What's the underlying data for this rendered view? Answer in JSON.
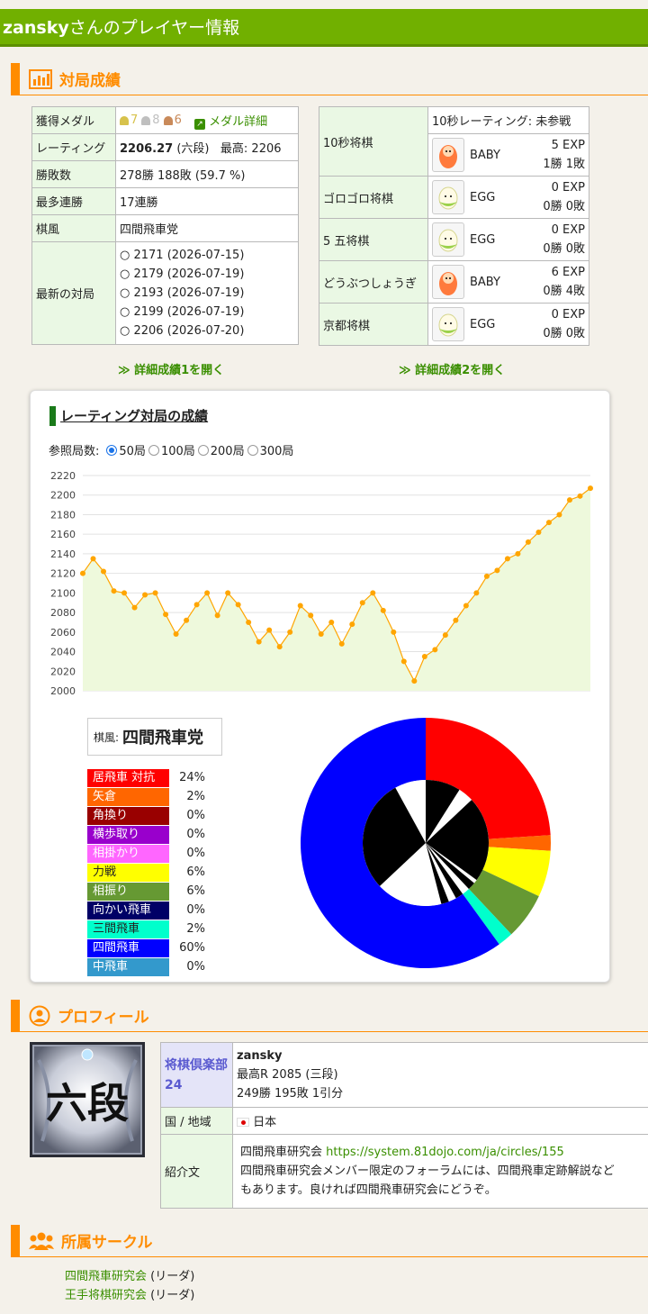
{
  "header": {
    "username": "zansky",
    "title_suffix": "さんのプレイヤー情報"
  },
  "sections": {
    "results": "対局成績",
    "profile": "プロフィール",
    "circles": "所属サークル"
  },
  "stats_table": {
    "medal_label": "獲得メダル",
    "medals": [
      {
        "count": "7",
        "color": "#d7c24c"
      },
      {
        "count": "8",
        "color": "#bfbfbf"
      },
      {
        "count": "6",
        "color": "#c98a5a"
      }
    ],
    "medal_link": "メダル詳細",
    "rating_label": "レーティング",
    "rating_value": "2206.27",
    "rating_rank": "(六段)",
    "rating_max": "最高: 2206",
    "record_label": "勝敗数",
    "record_value": "278勝 188敗 (59.7 %)",
    "streak_label": "最多連勝",
    "streak_value": "17連勝",
    "style_label": "棋風",
    "style_value": "四間飛車党",
    "recent_label": "最新の対局",
    "recent_games": [
      "○ 2171 (2026-07-15)",
      "○ 2179 (2026-07-19)",
      "○ 2193 (2026-07-19)",
      "○ 2199 (2026-07-19)",
      "○ 2206 (2026-07-20)"
    ]
  },
  "variants_table": {
    "ten_sec": {
      "label": "10秒将棋",
      "rating": "10秒レーティング: 未参戦",
      "rank": "BABY",
      "exp": "5 EXP",
      "record": "1勝 1敗"
    },
    "rows": [
      {
        "label": "ゴロゴロ将棋",
        "rank": "EGG",
        "exp": "0 EXP",
        "record": "0勝 0敗"
      },
      {
        "label": " 5 五将棋",
        "rank": "EGG",
        "exp": "0 EXP",
        "record": "0勝 0敗"
      },
      {
        "label": "どうぶつしょうぎ",
        "rank": "BABY",
        "exp": "6 EXP",
        "record": "0勝 4敗"
      },
      {
        "label": "京都将棋",
        "rank": "EGG",
        "exp": "0 EXP",
        "record": "0勝 0敗"
      }
    ]
  },
  "open_links": {
    "detail1": "詳細成績1を開く",
    "detail2": "詳細成績2を開く"
  },
  "rating_card": {
    "title": "レーティング対局の成績",
    "games_label": "参照局数:",
    "options": [
      "50局",
      "100局",
      "200局",
      "300局"
    ],
    "selected": "50局",
    "style_key": "棋風:",
    "style_value": "四間飛車党",
    "legend": [
      {
        "name": "居飛車 対抗",
        "pct": "24%",
        "color": "#ff0000"
      },
      {
        "name": "矢倉",
        "pct": "2%",
        "color": "#ff6600"
      },
      {
        "name": "角換り",
        "pct": "0%",
        "color": "#990000"
      },
      {
        "name": "横歩取り",
        "pct": "0%",
        "color": "#9900cc"
      },
      {
        "name": "相掛かり",
        "pct": "0%",
        "color": "#ff66ff"
      },
      {
        "name": "力戦",
        "pct": "6%",
        "color": "#ffff00"
      },
      {
        "name": "相振り",
        "pct": "6%",
        "color": "#669933"
      },
      {
        "name": "向かい飛車",
        "pct": "0%",
        "color": "#000066"
      },
      {
        "name": "三間飛車",
        "pct": "2%",
        "color": "#00ffcc"
      },
      {
        "name": "四間飛車",
        "pct": "60%",
        "color": "#0000ff"
      },
      {
        "name": "中飛車",
        "pct": "0%",
        "color": "#3399cc"
      }
    ]
  },
  "chart_data": {
    "type": "area",
    "title": "",
    "xlabel": "",
    "ylabel": "",
    "ylim": [
      2000,
      2220
    ],
    "yticks": [
      "2220",
      "2200",
      "2180",
      "2160",
      "2140",
      "2120",
      "2100",
      "2080",
      "2060",
      "2040",
      "2020",
      "2000"
    ],
    "series": [
      {
        "values": [
          2120,
          2135,
          2122,
          2102,
          2100,
          2085,
          2098,
          2100,
          2078,
          2058,
          2072,
          2088,
          2100,
          2077,
          2100,
          2088,
          2070,
          2050,
          2062,
          2045,
          2060,
          2087,
          2077,
          2058,
          2070,
          2048,
          2068,
          2090,
          2100,
          2082,
          2060,
          2030,
          2010,
          2035,
          2042,
          2057,
          2072,
          2087,
          2100,
          2117,
          2123,
          2135,
          2140,
          2152,
          2162,
          2172,
          2180,
          2195,
          2199,
          2207
        ]
      }
    ],
    "line_color": "#ffa500",
    "fill_color": "#eef9dc",
    "grid": true
  },
  "profile": {
    "rank_badge": "六段",
    "club": "将棋倶楽部24",
    "username": "zansky",
    "max_rating": "最高R 2085 (三段)",
    "record": "249勝 195敗 1引分",
    "country_label": "国 / 地域",
    "country_value": "日本",
    "intro_label": "紹介文",
    "intro_line1": "四間飛車研究会 ",
    "intro_url": "https://system.81dojo.com/ja/circles/155",
    "intro_line2": "四間飛車研究会メンバー限定のフォーラムには、四間飛車定跡解説など",
    "intro_line3": "もあります。良ければ四間飛車研究会にどうぞ。"
  },
  "circles": [
    {
      "name": "四間飛車研究会",
      "role": "(リーダ)"
    },
    {
      "name": "王手将棋研究会",
      "role": "(リーダ)"
    }
  ]
}
